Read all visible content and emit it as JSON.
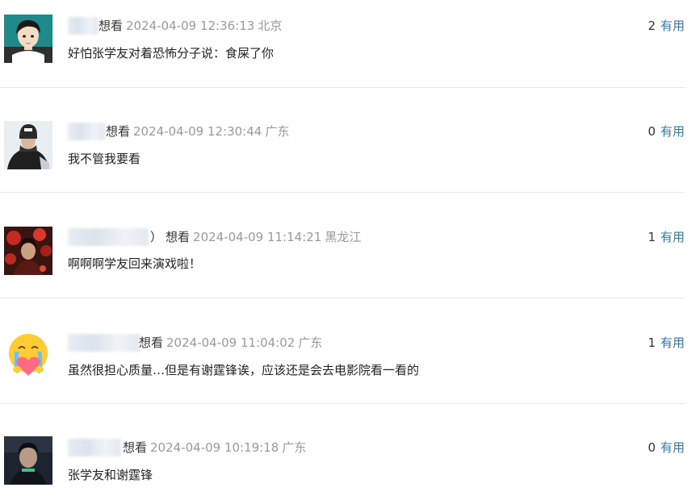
{
  "comments": [
    {
      "name_suffix": "",
      "status": "想看",
      "time": "2024-04-09 12:36:13",
      "location": "北京",
      "vote_count": "2",
      "vote_label": "有用",
      "content": "好怕张学友对着恐怖分子说：食屎了你",
      "avatar_icon": "avatar-anime-boy"
    },
    {
      "name_suffix": "",
      "status": "想看",
      "time": "2024-04-09 12:30:44",
      "location": "广东",
      "vote_count": "0",
      "vote_label": "有用",
      "content": "我不管我要看",
      "avatar_icon": "avatar-winter-person"
    },
    {
      "name_suffix": "）",
      "status": "想看",
      "time": "2024-04-09 11:14:21",
      "location": "黑龙江",
      "vote_count": "1",
      "vote_label": "有用",
      "content": "啊啊啊学友回来演戏啦！",
      "avatar_icon": "avatar-red-scene"
    },
    {
      "name_suffix": "",
      "status": "想看",
      "time": "2024-04-09 11:04:02",
      "location": "广东",
      "vote_count": "1",
      "vote_label": "有用",
      "content": "虽然很担心质量…但是有谢霆锋诶，应该还是会去电影院看一看的",
      "avatar_icon": "avatar-crying-emoji"
    },
    {
      "name_suffix": "",
      "status": "想看",
      "time": "2024-04-09 10:19:18",
      "location": "广东",
      "vote_count": "0",
      "vote_label": "有用",
      "content": "张学友和谢霆锋",
      "avatar_icon": "avatar-dark-portrait"
    }
  ],
  "colors": {
    "link": "#3377aa",
    "meta_gray": "#999999",
    "divider": "#e8e8e8"
  }
}
